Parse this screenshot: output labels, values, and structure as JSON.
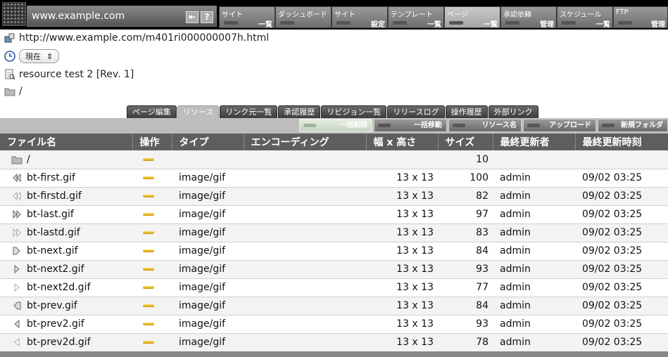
{
  "header": {
    "site_name": "www.example.com",
    "help_label": "?",
    "nav": [
      {
        "l1": "サイト",
        "l2": "一覧",
        "width": 80,
        "active": false
      },
      {
        "l1": "ダッシュボード",
        "l2": "",
        "width": 80,
        "active": false
      },
      {
        "l1": "サイト",
        "l2": "設定",
        "width": 80,
        "active": false
      },
      {
        "l1": "テンプレート",
        "l2": "一覧",
        "width": 80,
        "active": false
      },
      {
        "l1": "ページ",
        "l2": "一覧",
        "width": 80,
        "active": true
      },
      {
        "l1": "承認依頼",
        "l2": "管理",
        "width": 80,
        "active": false
      },
      {
        "l1": "スケジュール",
        "l2": "一覧",
        "width": 80,
        "active": false
      },
      {
        "l1": "FTP",
        "l2": "管理",
        "width": 78,
        "active": false
      }
    ]
  },
  "info": {
    "url": "http://www.example.com/m401ri000000007h.html",
    "status_value": "現在",
    "resource_title": "resource test 2 [Rev. 1]",
    "folder_path": "/"
  },
  "tabs": [
    {
      "label": "ページ編集",
      "active": false
    },
    {
      "label": "リソース",
      "active": true
    },
    {
      "label": "リンク元一覧",
      "active": false
    },
    {
      "label": "承認履歴",
      "active": false
    },
    {
      "label": "リビジョン一覧",
      "active": false
    },
    {
      "label": "リリースログ",
      "active": false
    },
    {
      "label": "操作履歴",
      "active": false
    },
    {
      "label": "外部リンク",
      "active": false
    }
  ],
  "actions": [
    {
      "label": "一括削除",
      "light": true
    },
    {
      "label": "一括移動",
      "light": false
    },
    {
      "label": "リソース名",
      "light": false
    },
    {
      "label": "アップロード",
      "light": false
    },
    {
      "label": "新規フォルダ",
      "light": false
    }
  ],
  "columns": [
    "ファイル名",
    "操作",
    "タイプ",
    "エンコーディング",
    "幅 x 高さ",
    "サイズ",
    "最終更新者",
    "最終更新時刻"
  ],
  "folder_row": {
    "name": "/",
    "size": "10"
  },
  "rows": [
    {
      "name": "bt-first.gif",
      "icon": "first",
      "type": "image/gif",
      "dims": "13 x 13",
      "size": "100",
      "user": "admin",
      "time": "09/02 03:25"
    },
    {
      "name": "bt-firstd.gif",
      "icon": "first-disabled",
      "type": "image/gif",
      "dims": "13 x 13",
      "size": "82",
      "user": "admin",
      "time": "09/02 03:25"
    },
    {
      "name": "bt-last.gif",
      "icon": "last",
      "type": "image/gif",
      "dims": "13 x 13",
      "size": "97",
      "user": "admin",
      "time": "09/02 03:25"
    },
    {
      "name": "bt-lastd.gif",
      "icon": "last-disabled",
      "type": "image/gif",
      "dims": "13 x 13",
      "size": "83",
      "user": "admin",
      "time": "09/02 03:25"
    },
    {
      "name": "bt-next.gif",
      "icon": "next",
      "type": "image/gif",
      "dims": "13 x 13",
      "size": "84",
      "user": "admin",
      "time": "09/02 03:25"
    },
    {
      "name": "bt-next2.gif",
      "icon": "next2",
      "type": "image/gif",
      "dims": "13 x 13",
      "size": "93",
      "user": "admin",
      "time": "09/02 03:25"
    },
    {
      "name": "bt-next2d.gif",
      "icon": "next2-disabled",
      "type": "image/gif",
      "dims": "13 x 13",
      "size": "77",
      "user": "admin",
      "time": "09/02 03:25"
    },
    {
      "name": "bt-prev.gif",
      "icon": "prev",
      "type": "image/gif",
      "dims": "13 x 13",
      "size": "84",
      "user": "admin",
      "time": "09/02 03:25"
    },
    {
      "name": "bt-prev2.gif",
      "icon": "prev2",
      "type": "image/gif",
      "dims": "13 x 13",
      "size": "93",
      "user": "admin",
      "time": "09/02 03:25"
    },
    {
      "name": "bt-prev2d.gif",
      "icon": "prev2-disabled",
      "type": "image/gif",
      "dims": "13 x 13",
      "size": "78",
      "user": "admin",
      "time": "09/02 03:25"
    }
  ]
}
